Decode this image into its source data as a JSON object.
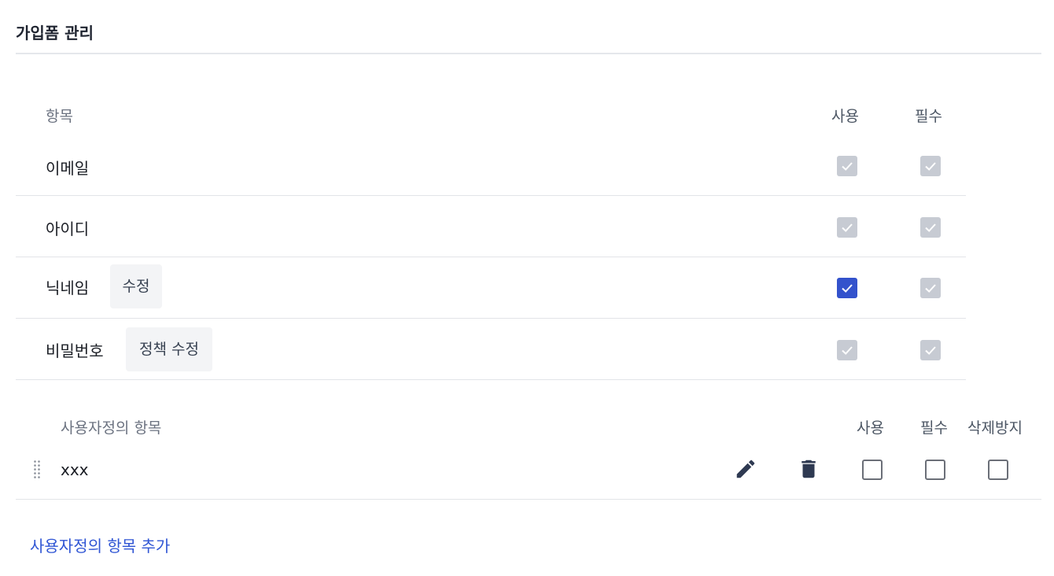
{
  "header": {
    "title": "가입폼 관리"
  },
  "fixed_section": {
    "headers": {
      "item": "항목",
      "use": "사용",
      "required": "필수"
    },
    "rows": [
      {
        "label": "이메일",
        "use": "checked-disabled",
        "required": "checked-disabled"
      },
      {
        "label": "아이디",
        "use": "checked-disabled",
        "required": "checked-disabled"
      },
      {
        "label": "닉네임",
        "action": "수정",
        "use": "checked",
        "required": "checked-disabled"
      },
      {
        "label": "비밀번호",
        "action": "정책 수정",
        "use": "checked-disabled",
        "required": "checked-disabled"
      }
    ]
  },
  "custom_section": {
    "headers": {
      "item": "사용자정의 항목",
      "use": "사용",
      "required": "필수",
      "protect": "삭제방지"
    },
    "rows": [
      {
        "label": "xxx",
        "use": "unchecked",
        "required": "unchecked",
        "protect": "unchecked",
        "icons": [
          "drag-handle-icon",
          "pencil-icon",
          "trash-icon"
        ]
      }
    ],
    "add_label": "사용자정의 항목 추가"
  },
  "colors": {
    "accent": "#3352cc",
    "link": "#2f55d4",
    "disabled_check": "#c7cbd3",
    "icon": "#2f3a52"
  }
}
